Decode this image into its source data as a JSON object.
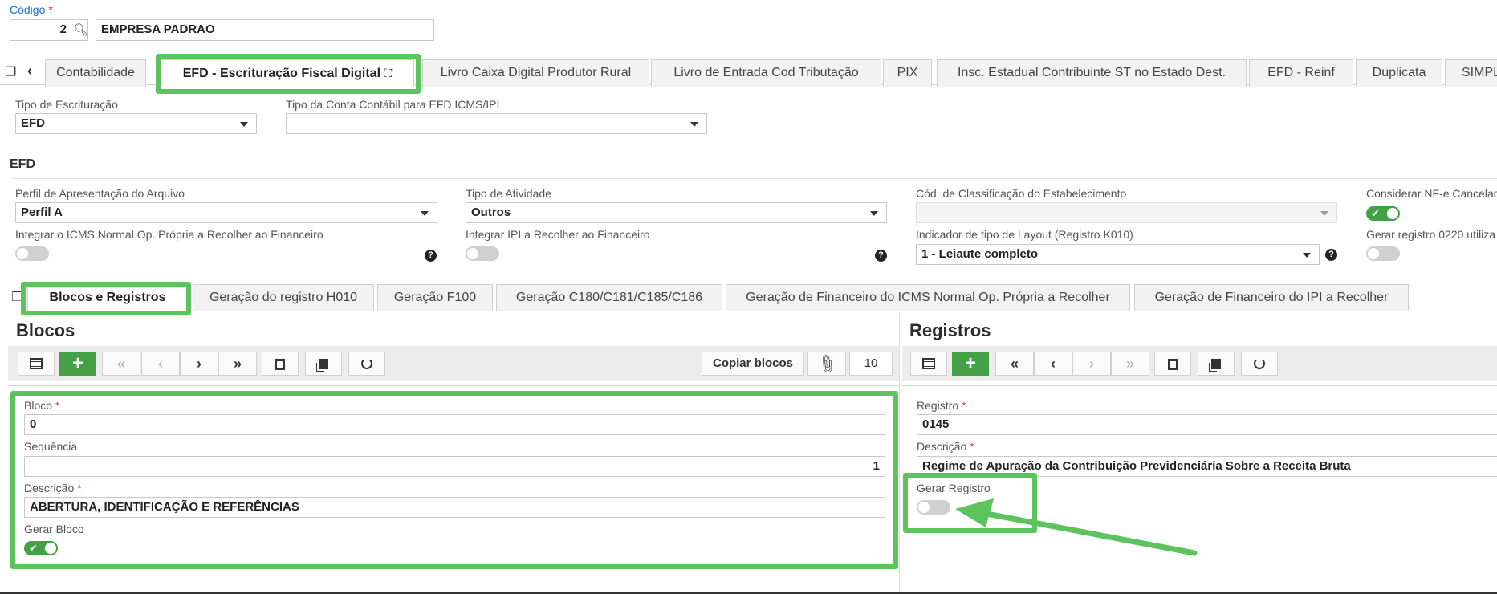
{
  "header": {
    "code_label": "Código",
    "code_value": "2",
    "company_name": "EMPRESA PADRAO"
  },
  "main_tabs": [
    {
      "label": "Contabilidade"
    },
    {
      "label": "EFD - Escrituração Fiscal Digital"
    },
    {
      "label": "Livro Caixa Digital Produtor Rural"
    },
    {
      "label": "Livro de Entrada Cod Tributação"
    },
    {
      "label": "PIX"
    },
    {
      "label": "Insc. Estadual Contribuinte ST no Estado Dest."
    },
    {
      "label": "EFD - Reinf"
    },
    {
      "label": "Duplicata"
    },
    {
      "label": "SIMPL"
    }
  ],
  "fields": {
    "tipo_escrituracao_label": "Tipo de Escrituração",
    "tipo_escrituracao_value": "EFD",
    "tipo_conta_label": "Tipo da Conta Contábil para EFD ICMS/IPI",
    "tipo_conta_value": "",
    "efd_section": "EFD",
    "perfil_label": "Perfil de Apresentação do Arquivo",
    "perfil_value": "Perfil A",
    "tipo_atividade_label": "Tipo de Atividade",
    "tipo_atividade_value": "Outros",
    "cod_class_label": "Cód. de Classificação do Estabelecimento",
    "cod_class_value": "",
    "considerar_label": "Considerar NF-e Cancelad",
    "considerar_on": true,
    "integrar_icms_label": "Integrar o ICMS Normal Op. Própria a Recolher ao Financeiro",
    "integrar_icms_on": false,
    "integrar_ipi_label": "Integrar IPI a Recolher ao Financeiro",
    "integrar_ipi_on": false,
    "indicador_label": "Indicador de tipo de Layout (Registro K010)",
    "indicador_value": "1 - Leiaute completo",
    "gerar_0220_label": "Gerar registro 0220 utiliza",
    "gerar_0220_on": false
  },
  "sub_tabs": [
    {
      "label": "Blocos e Registros"
    },
    {
      "label": "Geração do registro H010"
    },
    {
      "label": "Geração F100"
    },
    {
      "label": "Geração C180/C181/C185/C186"
    },
    {
      "label": "Geração de Financeiro do ICMS Normal Op. Própria a Recolher"
    },
    {
      "label": "Geração de Financeiro do IPI a Recolher"
    }
  ],
  "blocos": {
    "title": "Blocos",
    "copy_button": "Copiar blocos",
    "page_size": "10",
    "bloco_label": "Bloco",
    "bloco_value": "0",
    "sequencia_label": "Sequência",
    "sequencia_value": "1",
    "descricao_label": "Descrição",
    "descricao_value": "ABERTURA, IDENTIFICAÇÃO E REFERÊNCIAS",
    "gerar_label": "Gerar Bloco",
    "gerar_on": true
  },
  "registros": {
    "title": "Registros",
    "registro_label": "Registro",
    "registro_value": "0145",
    "descricao_label": "Descrição",
    "descricao_value": "Regime de Apuração da Contribuição Previdenciária Sobre a Receita Bruta",
    "gerar_label": "Gerar Registro",
    "gerar_on": false
  },
  "colors": {
    "highlight": "#5cc45c",
    "accent_green": "#43a047",
    "required": "#e53935"
  },
  "icons": {
    "grid": "grid-icon",
    "add": "plus-icon",
    "first": "double-chevron-left-icon",
    "prev": "chevron-left-icon",
    "next": "chevron-right-icon",
    "last": "double-chevron-right-icon",
    "delete": "trash-icon",
    "copy": "copy-icon",
    "refresh": "refresh-icon",
    "attach": "paperclip-icon"
  }
}
